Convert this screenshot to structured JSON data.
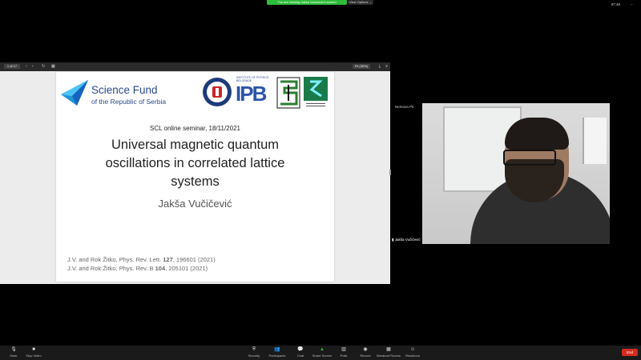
{
  "banner": {
    "text": "You are viewing Jaksa Vucicevic's screen",
    "view_options": "View Options ⌄"
  },
  "clock": "07:48",
  "pdf_toolbar": {
    "page": "1 of 17",
    "zoom": "Fit (35%)"
  },
  "slide": {
    "logo_line1": "Science Fund",
    "logo_line2": "of the Republic of Serbia",
    "ipb_small": [
      "INSTITUTE OF PHYSICS",
      "BELGRADE"
    ],
    "ipb_text": "IPB",
    "seminar": "SCL online seminar, 18/11/2021",
    "title_lines": [
      "Universal magnetic quantum",
      "oscillations in correlated lattice",
      "systems"
    ],
    "author": "Jakša Vučičević",
    "refs": [
      {
        "pre": "J.V. and Rok Žitko, Phys. Rev. Lett. ",
        "bold": "127",
        "post": ", 196601 (2021)"
      },
      {
        "pre": "J.V. and Rok Žitko, Phys. Rev. B ",
        "bold": "104",
        "post": ", 205101 (2021)"
      }
    ]
  },
  "video": {
    "self_label": "Nemova Ptr",
    "name": "Jakša Vučičević"
  },
  "bottom_bar": {
    "left": [
      {
        "label": "Mute",
        "icon": "microphone-icon"
      },
      {
        "label": "Stop Video",
        "icon": "video-camera-icon"
      }
    ],
    "center": [
      {
        "label": "Security",
        "icon": "shield-icon"
      },
      {
        "label": "Participants",
        "icon": "participants-icon"
      },
      {
        "label": "Chat",
        "icon": "chat-icon"
      },
      {
        "label": "Share Screen",
        "icon": "share-screen-icon"
      },
      {
        "label": "Polls",
        "icon": "polls-icon"
      },
      {
        "label": "Record",
        "icon": "record-icon"
      },
      {
        "label": "Breakout Rooms",
        "icon": "breakout-rooms-icon"
      },
      {
        "label": "Reactions",
        "icon": "reactions-icon"
      }
    ],
    "end": "End"
  },
  "colors": {
    "share_green": "#2ebd3b",
    "end_red": "#d52b1e",
    "logo_blue": "#2c4a8c"
  }
}
